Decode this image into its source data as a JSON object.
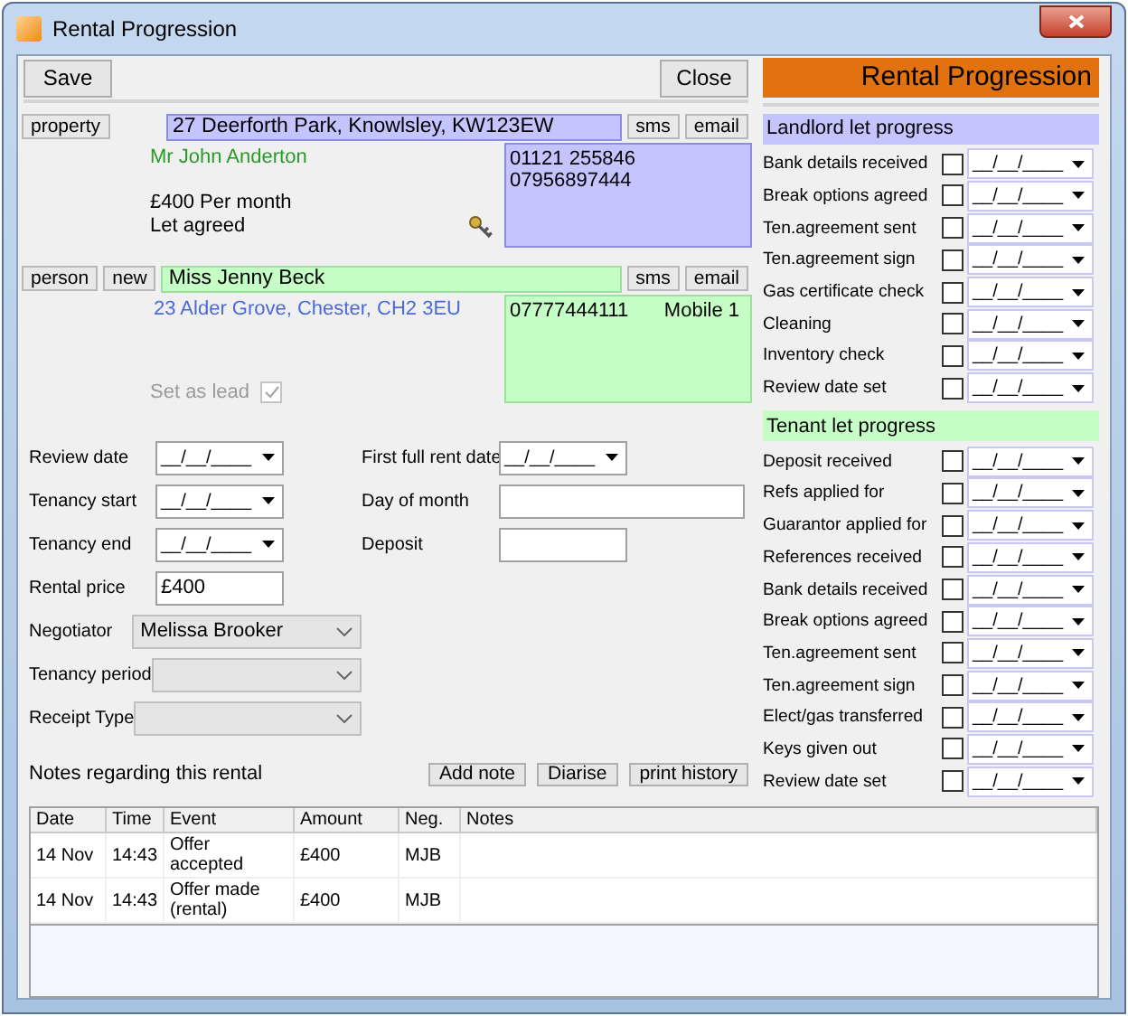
{
  "window": {
    "title": "Rental Progression"
  },
  "toolbar": {
    "buttons": [
      "Save",
      "Close"
    ],
    "banner": "Rental Progression"
  },
  "property": {
    "button": "property",
    "address": "27 Deerforth Park, Knowlsley, KW123EW",
    "actions": [
      "sms",
      "email"
    ],
    "owner": "Mr John Anderton",
    "price": "£400 Per month",
    "status": "Let agreed",
    "phones": [
      "01121 255846",
      "07956897444"
    ]
  },
  "person": {
    "buttons": [
      "person",
      "new"
    ],
    "name": "Miss Jenny Beck",
    "actions": [
      "sms",
      "email"
    ],
    "address": "23 Alder Grove, Chester, CH2 3EU",
    "phone": "07777444111",
    "phone_type": "Mobile 1",
    "lead": {
      "label": "Set as lead",
      "checked": true,
      "disabled": true
    }
  },
  "form_left": [
    {
      "label": "Review date",
      "kind": "date",
      "value": "__/__/____"
    },
    {
      "label": "Tenancy start",
      "kind": "date",
      "value": "__/__/____"
    },
    {
      "label": "Tenancy end",
      "kind": "date",
      "value": "__/__/____"
    },
    {
      "label": "Rental price",
      "kind": "text",
      "value": "£400"
    },
    {
      "label": "Negotiator",
      "kind": "select",
      "value": "Melissa Brooker"
    },
    {
      "label": "Tenancy period",
      "kind": "select"
    },
    {
      "label": "Receipt Type",
      "kind": "select"
    }
  ],
  "form_right": [
    {
      "label": "First full rent date",
      "kind": "date",
      "value": "__/__/____"
    },
    {
      "label": "Day of month",
      "kind": "wide"
    },
    {
      "label": "Deposit",
      "kind": "text"
    }
  ],
  "notes": {
    "label": "Notes regarding this rental",
    "buttons": [
      "Add note",
      "Diarise",
      "print history"
    ]
  },
  "table": {
    "columns": [
      "Date",
      "Time",
      "Event",
      "Amount",
      "Neg.",
      "Notes"
    ],
    "rows": [
      [
        "14 Nov",
        "14:43",
        "Offer accepted",
        "£400",
        "MJB"
      ],
      [
        "14 Nov",
        "14:43",
        "Offer made (rental)",
        "£400",
        "MJB"
      ]
    ]
  },
  "landlord": {
    "title": "Landlord let progress",
    "items": [
      {
        "label": "Bank details received",
        "checked": false,
        "date": "__/__/____"
      },
      {
        "label": "Break options agreed",
        "checked": false,
        "date": "__/__/____"
      },
      {
        "label": "Ten.agreement sent",
        "checked": false,
        "date": "__/__/____"
      },
      {
        "label": "Ten.agreement sign",
        "checked": false,
        "date": "__/__/____"
      },
      {
        "label": "Gas certificate check",
        "checked": false,
        "date": "__/__/____"
      },
      {
        "label": "Cleaning",
        "checked": false,
        "date": "__/__/____"
      },
      {
        "label": "Inventory check",
        "checked": false,
        "date": "__/__/____"
      },
      {
        "label": "Review date set",
        "checked": false,
        "date": "__/__/____"
      }
    ]
  },
  "tenant": {
    "title": "Tenant let progress",
    "items": [
      {
        "label": "Deposit received",
        "checked": false,
        "date": "__/__/____"
      },
      {
        "label": "Refs applied for",
        "checked": false,
        "date": "__/__/____"
      },
      {
        "label": "Guarantor applied for",
        "checked": false,
        "date": "__/__/____"
      },
      {
        "label": "References received",
        "checked": false,
        "date": "__/__/____"
      },
      {
        "label": "Bank details received",
        "checked": false,
        "date": "__/__/____"
      },
      {
        "label": "Break options agreed",
        "checked": false,
        "date": "__/__/____"
      },
      {
        "label": "Ten.agreement sent",
        "checked": false,
        "date": "__/__/____"
      },
      {
        "label": "Ten.agreement sign",
        "checked": false,
        "date": "__/__/____"
      },
      {
        "label": "Elect/gas transferred",
        "checked": false,
        "date": "__/__/____"
      },
      {
        "label": "Keys given out",
        "checked": false,
        "date": "__/__/____"
      },
      {
        "label": "Review date set",
        "checked": false,
        "date": "__/__/____"
      }
    ]
  }
}
